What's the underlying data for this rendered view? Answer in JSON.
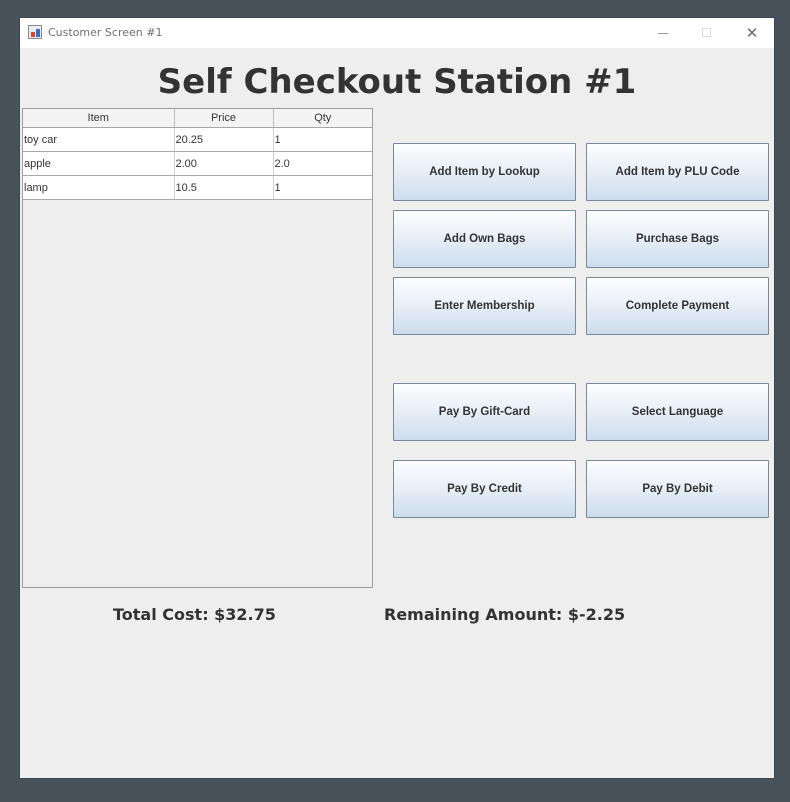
{
  "window": {
    "title": "Customer Screen #1",
    "minimize_glyph": "",
    "maximize_glyph": "",
    "close_glyph": "✕"
  },
  "heading": "Self Checkout Station #1",
  "table": {
    "columns": [
      "Item",
      "Price",
      "Qty"
    ],
    "rows": [
      [
        "toy car",
        "20.25",
        "1"
      ],
      [
        "apple",
        "2.00",
        "2.0"
      ],
      [
        "lamp",
        "10.5",
        "1"
      ]
    ]
  },
  "buttons": {
    "add_item_lookup": "Add Item by Lookup",
    "add_item_plu": "Add Item by PLU Code",
    "add_own_bags": "Add Own Bags",
    "purchase_bags": "Purchase Bags",
    "enter_membership": "Enter Membership",
    "complete_payment": "Complete Payment",
    "pay_gift_card": "Pay By Gift-Card",
    "select_language": "Select Language",
    "pay_credit": "Pay By Credit",
    "pay_debit": "Pay By Debit"
  },
  "totals": {
    "total_cost": "Total Cost: $32.75",
    "remaining_amount": "Remaining Amount: $-2.25"
  },
  "icons": {
    "app": "java-app-icon",
    "minimize": "minimize-icon",
    "maximize": "maximize-icon",
    "close": "close-icon"
  },
  "colors": {
    "desktop": "#47525a",
    "window_bg": "#eeeeee",
    "button_top": "#fdfeff",
    "button_bottom": "#cddced",
    "text": "#333333"
  }
}
